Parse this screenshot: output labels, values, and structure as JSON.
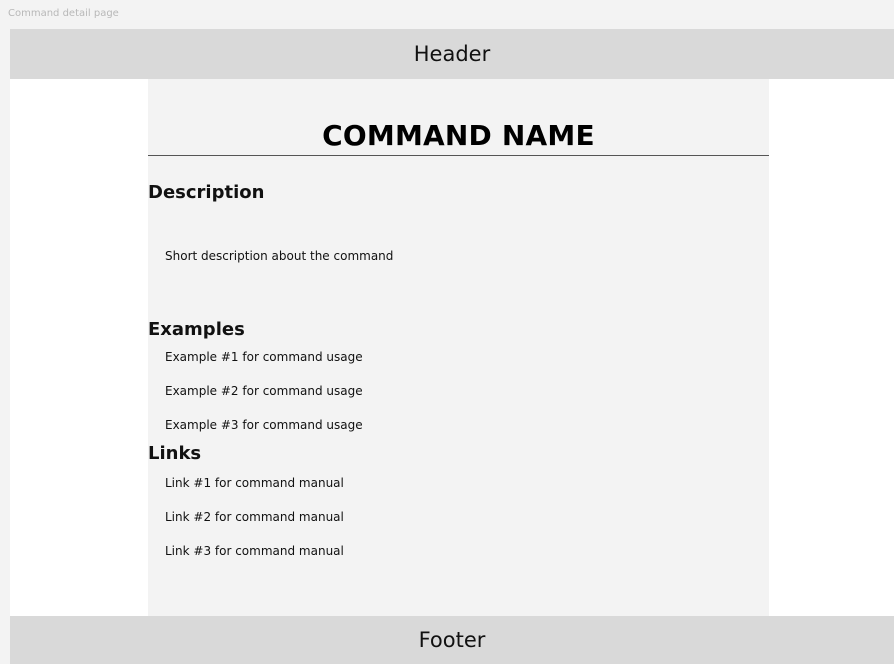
{
  "canvas": {
    "frame_label": "Command detail page"
  },
  "header": {
    "label": "Header"
  },
  "main": {
    "command_title": "COMMAND NAME",
    "description": {
      "heading": "Description",
      "text": "Short description about the command"
    },
    "examples": {
      "heading": "Examples",
      "items": [
        "Example #1 for command usage",
        "Example #2 for command usage",
        "Example #3 for command usage"
      ]
    },
    "links": {
      "heading": "Links",
      "items": [
        "Link #1 for command manual",
        "Link #2 for command manual",
        "Link #3 for command manual"
      ]
    }
  },
  "footer": {
    "label": "Footer"
  }
}
